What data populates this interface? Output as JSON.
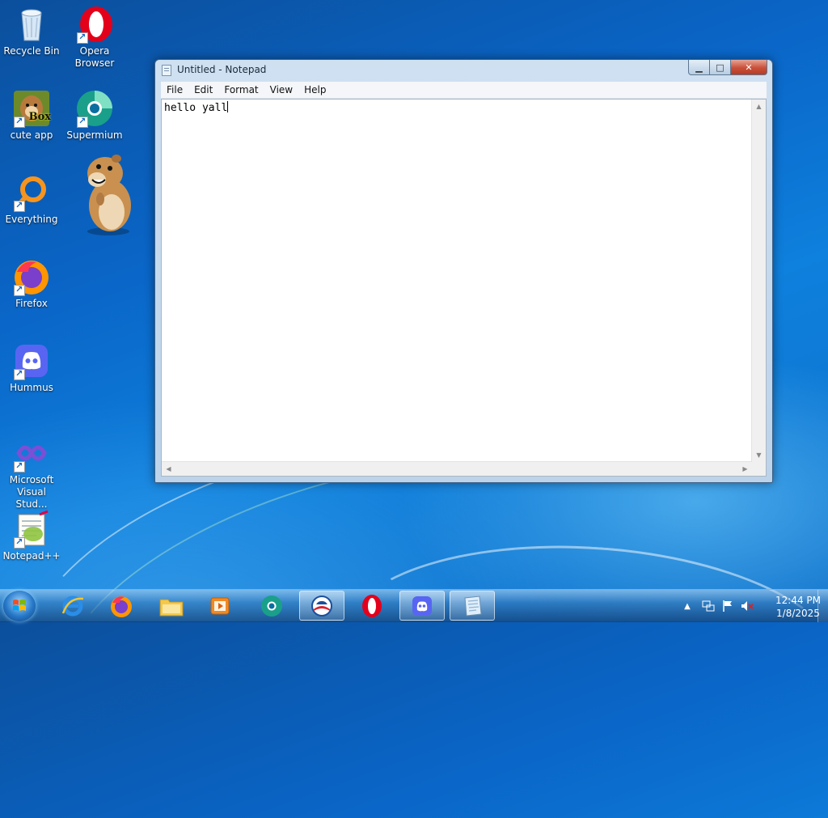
{
  "desktop": {
    "icons": [
      {
        "label": "Recycle Bin",
        "icon": "recycle-bin-icon"
      },
      {
        "label": "Opera\nBrowser",
        "icon": "opera-icon"
      },
      {
        "label": "cute app",
        "icon": "cute-app-icon",
        "badge": "Box"
      },
      {
        "label": "Supermium",
        "icon": "supermium-icon"
      },
      {
        "label": "Everything",
        "icon": "everything-icon"
      },
      {
        "label": "Firefox",
        "icon": "firefox-icon"
      },
      {
        "label": "Hummus",
        "icon": "discord-icon"
      },
      {
        "label": "Microsoft\nVisual Stud...",
        "icon": "visual-studio-icon"
      },
      {
        "label": "Notepad++",
        "icon": "notepadpp-icon"
      }
    ]
  },
  "notepad": {
    "title": "Untitled - Notepad",
    "menu": [
      "File",
      "Edit",
      "Format",
      "View",
      "Help"
    ],
    "content": "hello yall"
  },
  "taskbar": {
    "apps": [
      "internet-explorer",
      "firefox",
      "file-explorer",
      "media-player",
      "supermium",
      "obama",
      "opera",
      "discord",
      "notepad"
    ],
    "active": "notepad",
    "clock_time": "12:44 PM",
    "clock_date": "1/8/2025"
  },
  "colors": {
    "desktop_blue": "#0a66c8",
    "close_red": "#c9503a",
    "opera_red": "#e3001b",
    "discord": "#5865f2"
  }
}
